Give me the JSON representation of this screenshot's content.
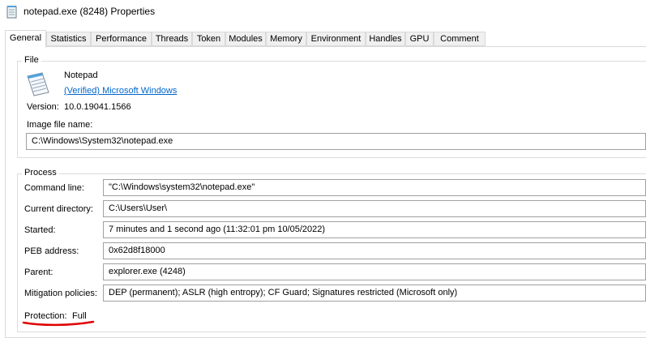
{
  "window": {
    "title": "notepad.exe (8248) Properties"
  },
  "tabs": [
    {
      "label": "General",
      "active": true
    },
    {
      "label": "Statistics"
    },
    {
      "label": "Performance"
    },
    {
      "label": "Threads"
    },
    {
      "label": "Token"
    },
    {
      "label": "Modules"
    },
    {
      "label": "Memory"
    },
    {
      "label": "Environment"
    },
    {
      "label": "Handles"
    },
    {
      "label": "GPU"
    },
    {
      "label": "Comment"
    }
  ],
  "file": {
    "group_title": "File",
    "name": "Notepad",
    "publisher": "(Verified) Microsoft Windows",
    "version_label": "Version:",
    "version": "10.0.19041.1566",
    "image_label": "Image file name:",
    "image_path": "C:\\Windows\\System32\\notepad.exe"
  },
  "process": {
    "group_title": "Process",
    "command_line_label": "Command line:",
    "command_line": "\"C:\\Windows\\system32\\notepad.exe\"",
    "current_directory_label": "Current directory:",
    "current_directory": "C:\\Users\\User\\",
    "started_label": "Started:",
    "started": "7 minutes and 1 second ago (11:32:01 pm 10/05/2022)",
    "peb_label": "PEB address:",
    "peb": "0x62d8f18000",
    "parent_label": "Parent:",
    "parent": "explorer.exe (4248)",
    "mitigation_label": "Mitigation policies:",
    "mitigation": "DEP (permanent); ASLR (high entropy); CF Guard; Signatures restricted (Microsoft only)",
    "protection_label": "Protection:",
    "protection": "Full"
  },
  "colors": {
    "link": "#0066cc",
    "annotation": "#e00000"
  }
}
